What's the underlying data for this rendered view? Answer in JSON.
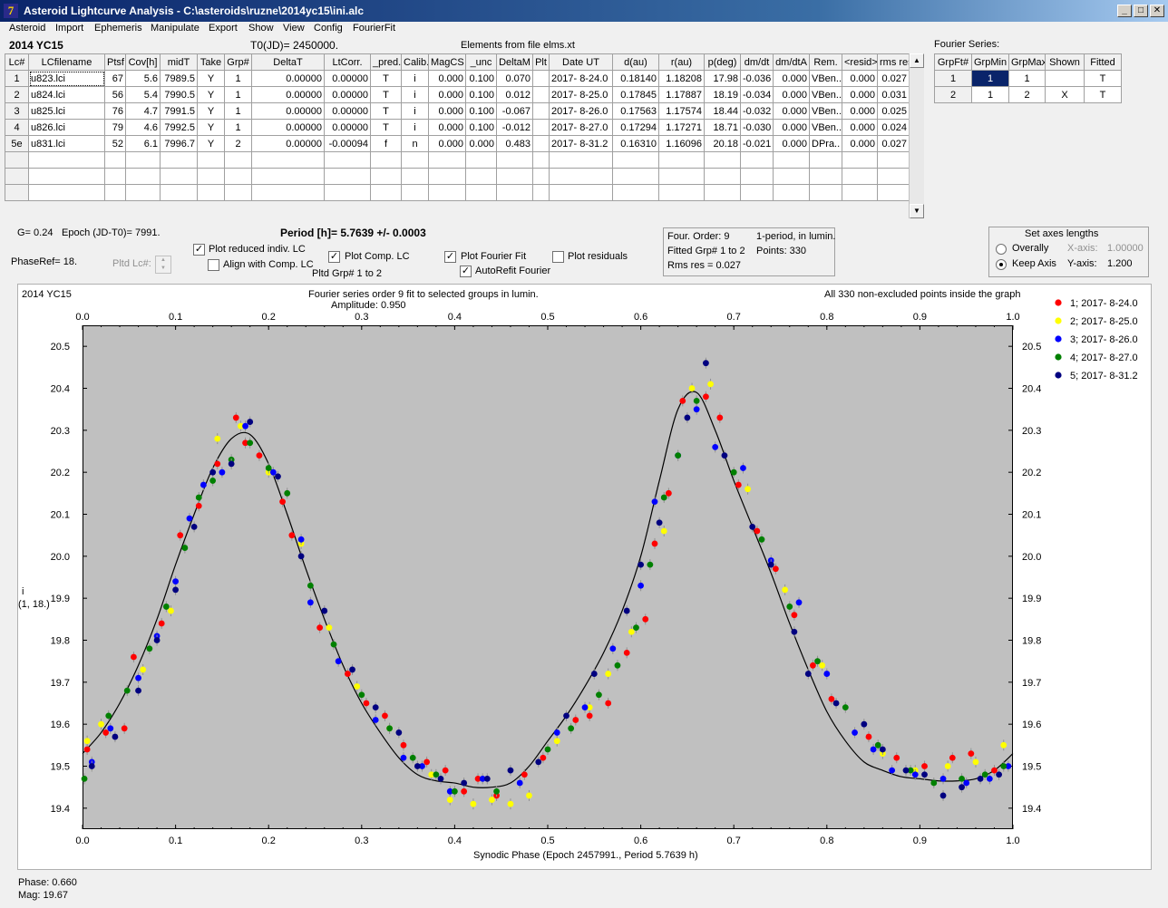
{
  "window": {
    "title": "Asteroid Lightcurve Analysis - C:\\asteroids\\ruzne\\2014yc15\\ini.alc",
    "icon_glyph": "7"
  },
  "menu": [
    "Asteroid",
    "Import",
    "Ephemeris",
    "Manipulate",
    "Export",
    "Show",
    "View",
    "Config",
    "FourierFit"
  ],
  "asteroid_name": "2014 YC15",
  "t0_label": "T0(JD)= 2450000.",
  "elements_label": "Elements from file elms.xt",
  "fourier_series_label": "Fourier Series:",
  "lc_table": {
    "headers": [
      "Lc#",
      "LCfilename",
      "Ptsf",
      "Cov[h]",
      "midT",
      "Take",
      "Grp#",
      "DeltaT",
      "LtCorr.",
      "_pred.",
      "Calib.",
      "MagCS",
      "_unc",
      "DeltaM",
      "Plt",
      "Date UT",
      "d(au)",
      "r(au)",
      "p(deg)",
      "dm/dt",
      "dm/dtA",
      "Rem.",
      "<resid>",
      "rms res"
    ],
    "rows": [
      [
        "1",
        "u823.lci",
        "67",
        "5.6",
        "7989.5",
        "Y",
        "1",
        "0.00000",
        "0.00000",
        "T",
        "i",
        "0.000",
        "0.100",
        "0.070",
        "",
        "2017- 8-24.0",
        "0.18140",
        "1.18208",
        "17.98",
        "-0.036",
        "0.000",
        "VBen..",
        "0.000",
        "0.027"
      ],
      [
        "2",
        "u824.lci",
        "56",
        "5.4",
        "7990.5",
        "Y",
        "1",
        "0.00000",
        "0.00000",
        "T",
        "i",
        "0.000",
        "0.100",
        "0.012",
        "",
        "2017- 8-25.0",
        "0.17845",
        "1.17887",
        "18.19",
        "-0.034",
        "0.000",
        "VBen..",
        "0.000",
        "0.031"
      ],
      [
        "3",
        "u825.lci",
        "76",
        "4.7",
        "7991.5",
        "Y",
        "1",
        "0.00000",
        "0.00000",
        "T",
        "i",
        "0.000",
        "0.100",
        "-0.067",
        "",
        "2017- 8-26.0",
        "0.17563",
        "1.17574",
        "18.44",
        "-0.032",
        "0.000",
        "VBen..",
        "0.000",
        "0.025"
      ],
      [
        "4",
        "u826.lci",
        "79",
        "4.6",
        "7992.5",
        "Y",
        "1",
        "0.00000",
        "0.00000",
        "T",
        "i",
        "0.000",
        "0.100",
        "-0.012",
        "",
        "2017- 8-27.0",
        "0.17294",
        "1.17271",
        "18.71",
        "-0.030",
        "0.000",
        "VBen..",
        "0.000",
        "0.024"
      ],
      [
        "5e",
        "u831.lci",
        "52",
        "6.1",
        "7996.7",
        "Y",
        "2",
        "0.00000",
        "-0.00094",
        "f",
        "n",
        "0.000",
        "0.000",
        "0.483",
        "",
        "2017- 8-31.2",
        "0.16310",
        "1.16096",
        "20.18",
        "-0.021",
        "0.000",
        "DPra..",
        "0.000",
        "0.027"
      ]
    ]
  },
  "fourier_table": {
    "headers": [
      "GrpFt#",
      "GrpMin",
      "GrpMax",
      "Shown",
      "Fitted"
    ],
    "rows": [
      [
        "1",
        "1",
        "1",
        "",
        "T"
      ],
      [
        "2",
        "1",
        "2",
        "X",
        "T"
      ]
    ]
  },
  "info": {
    "g_value": "G= 0.24",
    "epoch": "Epoch (JD-T0)= 7991.",
    "period": "Period [h]= 5.7639 +/- 0.0003",
    "phase_ref": "PhaseRef= 18.",
    "pltd_lc": "Pltd Lc#:"
  },
  "options": {
    "plot_reduced": {
      "label": "Plot reduced indiv. LC",
      "checked": true
    },
    "align_comp": {
      "label": "Align with Comp. LC",
      "checked": false
    },
    "plot_comp": {
      "label": "Plot Comp. LC",
      "checked": true
    },
    "pltd_grp": "Pltd Grp#  1   to   2",
    "plot_fourier": {
      "label": "Plot Fourier Fit",
      "checked": true
    },
    "autorefit": {
      "label": "AutoRefit Fourier",
      "checked": true
    },
    "plot_residuals": {
      "label": "Plot residuals",
      "checked": false
    }
  },
  "fourier_info": {
    "order": "Four. Order:  9",
    "period_mode": "1-period, in lumin.",
    "fitted": "Fitted Grp# 1 to 2",
    "points": "Points: 330",
    "rms": "Rms res      = 0.027"
  },
  "axes_box": {
    "title": "Set axes lengths",
    "overally": "Overally",
    "keep_axis": "Keep Axis",
    "xaxis_label": "X-axis:",
    "xaxis_value": "1.00000",
    "yaxis_label": "Y-axis:",
    "yaxis_value": "1.200",
    "selected": "keep_axis"
  },
  "status": {
    "phase": "Phase:  0.660",
    "mag": "Mag:    19.67"
  },
  "chart_data": {
    "type": "scatter",
    "title": "Fourier series order 9 fit to selected groups in lumin.",
    "subtitle": "Amplitude: 0.950",
    "corner_left": "2014 YC15",
    "corner_right": "All 330 non-excluded points inside the graph",
    "xlabel": "Synodic Phase (Epoch 2457991., Period 5.7639 h)",
    "ylabel": "i",
    "ylabel2": "(1, 18.)",
    "xlim": [
      0,
      1
    ],
    "ylim": [
      20.55,
      19.35
    ],
    "x_ticks": [
      "0.0",
      "0.1",
      "0.2",
      "0.3",
      "0.4",
      "0.5",
      "0.6",
      "0.7",
      "0.8",
      "0.9",
      "1.0"
    ],
    "y_ticks": [
      "19.4",
      "19.5",
      "19.6",
      "19.7",
      "19.8",
      "19.9",
      "20.0",
      "20.1",
      "20.2",
      "20.3",
      "20.4",
      "20.5"
    ],
    "fit_curve": {
      "x": [
        0.0,
        0.02,
        0.04,
        0.06,
        0.08,
        0.1,
        0.12,
        0.14,
        0.16,
        0.18,
        0.2,
        0.22,
        0.24,
        0.26,
        0.28,
        0.3,
        0.32,
        0.34,
        0.36,
        0.38,
        0.4,
        0.42,
        0.44,
        0.46,
        0.48,
        0.5,
        0.52,
        0.54,
        0.56,
        0.58,
        0.6,
        0.62,
        0.64,
        0.66,
        0.68,
        0.7,
        0.72,
        0.74,
        0.76,
        0.78,
        0.8,
        0.82,
        0.84,
        0.86,
        0.88,
        0.9,
        0.92,
        0.94,
        0.96,
        0.98,
        1.0
      ],
      "y": [
        19.53,
        19.58,
        19.65,
        19.74,
        19.85,
        19.98,
        20.1,
        20.21,
        20.28,
        20.29,
        20.22,
        20.1,
        19.97,
        19.85,
        19.74,
        19.65,
        19.58,
        19.52,
        19.48,
        19.465,
        19.46,
        19.45,
        19.45,
        19.46,
        19.5,
        19.56,
        19.62,
        19.69,
        19.77,
        19.87,
        20.0,
        20.18,
        20.35,
        20.39,
        20.3,
        20.18,
        20.07,
        19.96,
        19.84,
        19.73,
        19.63,
        19.56,
        19.51,
        19.49,
        19.475,
        19.47,
        19.465,
        19.465,
        19.47,
        19.49,
        19.53
      ]
    },
    "series": [
      {
        "name": "1; 2017- 8-24.0",
        "color": "#ff0000",
        "points": [
          [
            0.005,
            19.54
          ],
          [
            0.025,
            19.58
          ],
          [
            0.045,
            19.59
          ],
          [
            0.055,
            19.76
          ],
          [
            0.085,
            19.84
          ],
          [
            0.105,
            20.05
          ],
          [
            0.125,
            20.12
          ],
          [
            0.145,
            20.22
          ],
          [
            0.165,
            20.33
          ],
          [
            0.175,
            20.27
          ],
          [
            0.19,
            20.24
          ],
          [
            0.215,
            20.13
          ],
          [
            0.225,
            20.05
          ],
          [
            0.255,
            19.83
          ],
          [
            0.285,
            19.72
          ],
          [
            0.305,
            19.65
          ],
          [
            0.325,
            19.62
          ],
          [
            0.345,
            19.55
          ],
          [
            0.37,
            19.51
          ],
          [
            0.39,
            19.49
          ],
          [
            0.41,
            19.44
          ],
          [
            0.425,
            19.47
          ],
          [
            0.445,
            19.43
          ],
          [
            0.475,
            19.48
          ],
          [
            0.495,
            19.52
          ],
          [
            0.53,
            19.61
          ],
          [
            0.545,
            19.62
          ],
          [
            0.565,
            19.65
          ],
          [
            0.585,
            19.77
          ],
          [
            0.605,
            19.85
          ],
          [
            0.615,
            20.03
          ],
          [
            0.63,
            20.15
          ],
          [
            0.645,
            20.37
          ],
          [
            0.67,
            20.38
          ],
          [
            0.685,
            20.33
          ],
          [
            0.705,
            20.17
          ],
          [
            0.725,
            20.06
          ],
          [
            0.745,
            19.97
          ],
          [
            0.765,
            19.86
          ],
          [
            0.785,
            19.74
          ],
          [
            0.805,
            19.66
          ],
          [
            0.845,
            19.57
          ],
          [
            0.875,
            19.52
          ],
          [
            0.905,
            19.5
          ],
          [
            0.935,
            19.52
          ],
          [
            0.955,
            19.53
          ],
          [
            0.98,
            19.49
          ]
        ]
      },
      {
        "name": "2; 2017- 8-25.0",
        "color": "#ffff00",
        "points": [
          [
            0.005,
            19.56
          ],
          [
            0.02,
            19.6
          ],
          [
            0.065,
            19.73
          ],
          [
            0.095,
            19.87
          ],
          [
            0.145,
            20.28
          ],
          [
            0.17,
            20.31
          ],
          [
            0.2,
            20.2
          ],
          [
            0.235,
            20.03
          ],
          [
            0.265,
            19.83
          ],
          [
            0.295,
            19.69
          ],
          [
            0.33,
            19.59
          ],
          [
            0.375,
            19.48
          ],
          [
            0.395,
            19.42
          ],
          [
            0.42,
            19.41
          ],
          [
            0.44,
            19.42
          ],
          [
            0.46,
            19.41
          ],
          [
            0.48,
            19.43
          ],
          [
            0.51,
            19.56
          ],
          [
            0.545,
            19.64
          ],
          [
            0.565,
            19.72
          ],
          [
            0.59,
            19.82
          ],
          [
            0.625,
            20.06
          ],
          [
            0.655,
            20.4
          ],
          [
            0.675,
            20.41
          ],
          [
            0.715,
            20.16
          ],
          [
            0.755,
            19.92
          ],
          [
            0.795,
            19.74
          ],
          [
            0.86,
            19.53
          ],
          [
            0.895,
            19.49
          ],
          [
            0.93,
            19.5
          ],
          [
            0.96,
            19.51
          ],
          [
            0.99,
            19.55
          ]
        ]
      },
      {
        "name": "3; 2017- 8-26.0",
        "color": "#0000ff",
        "points": [
          [
            0.01,
            19.51
          ],
          [
            0.03,
            19.59
          ],
          [
            0.06,
            19.71
          ],
          [
            0.08,
            19.81
          ],
          [
            0.1,
            19.94
          ],
          [
            0.115,
            20.09
          ],
          [
            0.13,
            20.17
          ],
          [
            0.15,
            20.2
          ],
          [
            0.175,
            20.31
          ],
          [
            0.205,
            20.2
          ],
          [
            0.235,
            20.04
          ],
          [
            0.245,
            19.89
          ],
          [
            0.275,
            19.75
          ],
          [
            0.315,
            19.61
          ],
          [
            0.345,
            19.52
          ],
          [
            0.365,
            19.5
          ],
          [
            0.395,
            19.44
          ],
          [
            0.43,
            19.47
          ],
          [
            0.47,
            19.46
          ],
          [
            0.51,
            19.58
          ],
          [
            0.54,
            19.64
          ],
          [
            0.57,
            19.78
          ],
          [
            0.6,
            19.93
          ],
          [
            0.615,
            20.13
          ],
          [
            0.64,
            20.24
          ],
          [
            0.66,
            20.35
          ],
          [
            0.68,
            20.26
          ],
          [
            0.71,
            20.21
          ],
          [
            0.74,
            19.99
          ],
          [
            0.77,
            19.89
          ],
          [
            0.8,
            19.72
          ],
          [
            0.83,
            19.58
          ],
          [
            0.85,
            19.54
          ],
          [
            0.87,
            19.49
          ],
          [
            0.895,
            19.48
          ],
          [
            0.925,
            19.47
          ],
          [
            0.95,
            19.46
          ],
          [
            0.975,
            19.47
          ],
          [
            0.995,
            19.5
          ]
        ]
      },
      {
        "name": "4; 2017- 8-27.0",
        "color": "#008000",
        "points": [
          [
            0.002,
            19.47
          ],
          [
            0.028,
            19.62
          ],
          [
            0.048,
            19.68
          ],
          [
            0.072,
            19.78
          ],
          [
            0.09,
            19.88
          ],
          [
            0.11,
            20.02
          ],
          [
            0.125,
            20.14
          ],
          [
            0.14,
            20.18
          ],
          [
            0.16,
            20.23
          ],
          [
            0.18,
            20.27
          ],
          [
            0.2,
            20.21
          ],
          [
            0.22,
            20.15
          ],
          [
            0.245,
            19.93
          ],
          [
            0.27,
            19.79
          ],
          [
            0.3,
            19.67
          ],
          [
            0.33,
            19.59
          ],
          [
            0.355,
            19.52
          ],
          [
            0.38,
            19.48
          ],
          [
            0.4,
            19.44
          ],
          [
            0.445,
            19.44
          ],
          [
            0.5,
            19.54
          ],
          [
            0.525,
            19.59
          ],
          [
            0.555,
            19.67
          ],
          [
            0.575,
            19.74
          ],
          [
            0.595,
            19.83
          ],
          [
            0.61,
            19.98
          ],
          [
            0.625,
            20.14
          ],
          [
            0.64,
            20.24
          ],
          [
            0.66,
            20.37
          ],
          [
            0.7,
            20.2
          ],
          [
            0.73,
            20.04
          ],
          [
            0.76,
            19.88
          ],
          [
            0.79,
            19.75
          ],
          [
            0.82,
            19.64
          ],
          [
            0.855,
            19.55
          ],
          [
            0.89,
            19.49
          ],
          [
            0.915,
            19.46
          ],
          [
            0.945,
            19.47
          ],
          [
            0.97,
            19.48
          ],
          [
            0.99,
            19.5
          ]
        ]
      },
      {
        "name": "5; 2017- 8-31.2",
        "color": "#000080",
        "points": [
          [
            0.01,
            19.5
          ],
          [
            0.035,
            19.57
          ],
          [
            0.06,
            19.68
          ],
          [
            0.08,
            19.8
          ],
          [
            0.1,
            19.92
          ],
          [
            0.12,
            20.07
          ],
          [
            0.14,
            20.2
          ],
          [
            0.16,
            20.22
          ],
          [
            0.18,
            20.32
          ],
          [
            0.21,
            20.19
          ],
          [
            0.235,
            20.0
          ],
          [
            0.26,
            19.87
          ],
          [
            0.29,
            19.73
          ],
          [
            0.315,
            19.64
          ],
          [
            0.34,
            19.58
          ],
          [
            0.36,
            19.5
          ],
          [
            0.385,
            19.47
          ],
          [
            0.41,
            19.46
          ],
          [
            0.435,
            19.47
          ],
          [
            0.46,
            19.49
          ],
          [
            0.49,
            19.51
          ],
          [
            0.52,
            19.62
          ],
          [
            0.55,
            19.72
          ],
          [
            0.585,
            19.87
          ],
          [
            0.6,
            19.98
          ],
          [
            0.62,
            20.08
          ],
          [
            0.65,
            20.33
          ],
          [
            0.67,
            20.46
          ],
          [
            0.69,
            20.24
          ],
          [
            0.72,
            20.07
          ],
          [
            0.74,
            19.98
          ],
          [
            0.765,
            19.82
          ],
          [
            0.78,
            19.72
          ],
          [
            0.81,
            19.65
          ],
          [
            0.84,
            19.6
          ],
          [
            0.86,
            19.54
          ],
          [
            0.885,
            19.49
          ],
          [
            0.905,
            19.48
          ],
          [
            0.925,
            19.43
          ],
          [
            0.945,
            19.45
          ],
          [
            0.965,
            19.47
          ],
          [
            0.985,
            19.48
          ]
        ]
      }
    ]
  }
}
